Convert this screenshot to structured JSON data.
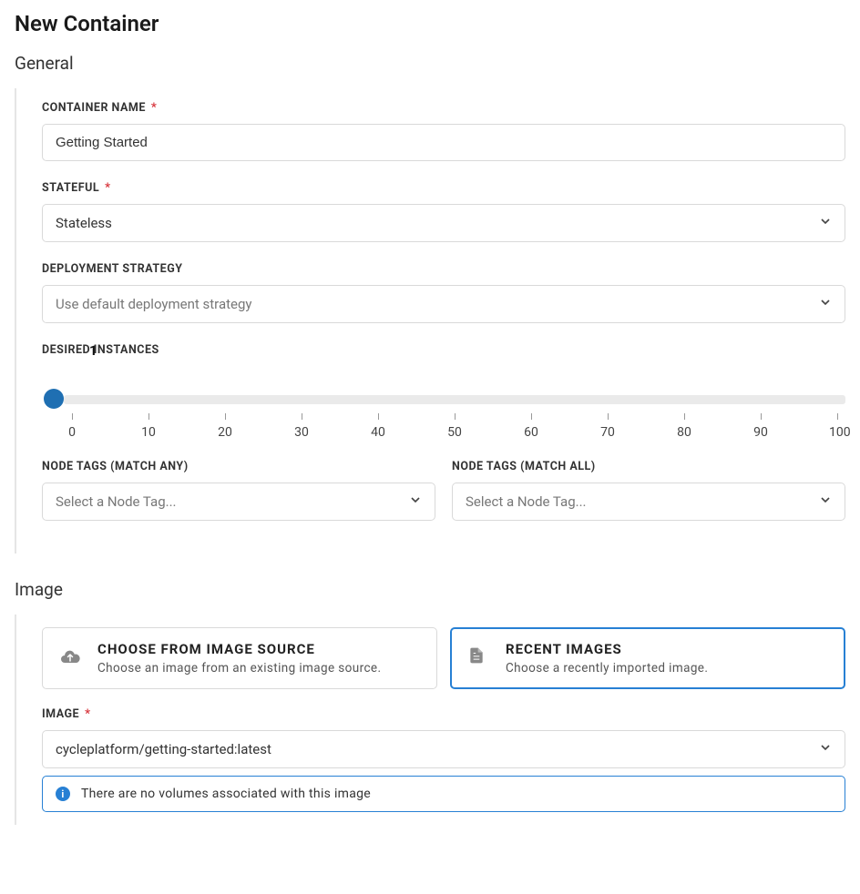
{
  "page_title": "New Container",
  "sections": {
    "general": {
      "title": "General",
      "container_name": {
        "label": "CONTAINER NAME",
        "required": true,
        "value": "Getting Started"
      },
      "stateful": {
        "label": "STATEFUL",
        "required": true,
        "value": "Stateless"
      },
      "deployment_strategy": {
        "label": "DEPLOYMENT STRATEGY",
        "required": false,
        "value": "Use default deployment strategy"
      },
      "desired_instances": {
        "label": "DESIRED INSTANCES",
        "value": 1,
        "min": 0,
        "max": 100,
        "ticks": [
          "0",
          "10",
          "20",
          "30",
          "40",
          "50",
          "60",
          "70",
          "80",
          "90",
          "100"
        ]
      },
      "node_tags_any": {
        "label": "NODE TAGS (MATCH ANY)",
        "placeholder": "Select a Node Tag..."
      },
      "node_tags_all": {
        "label": "NODE TAGS (MATCH ALL)",
        "placeholder": "Select a Node Tag..."
      }
    },
    "image": {
      "title": "Image",
      "option_source": {
        "title": "CHOOSE FROM IMAGE SOURCE",
        "sub": "Choose an image from an existing image source."
      },
      "option_recent": {
        "title": "RECENT IMAGES",
        "sub": "Choose a recently imported image."
      },
      "selected_option": "recent",
      "image_field": {
        "label": "IMAGE",
        "required": true,
        "value": "cycleplatform/getting-started:latest"
      },
      "info_message": "There are no volumes associated with this image"
    }
  }
}
